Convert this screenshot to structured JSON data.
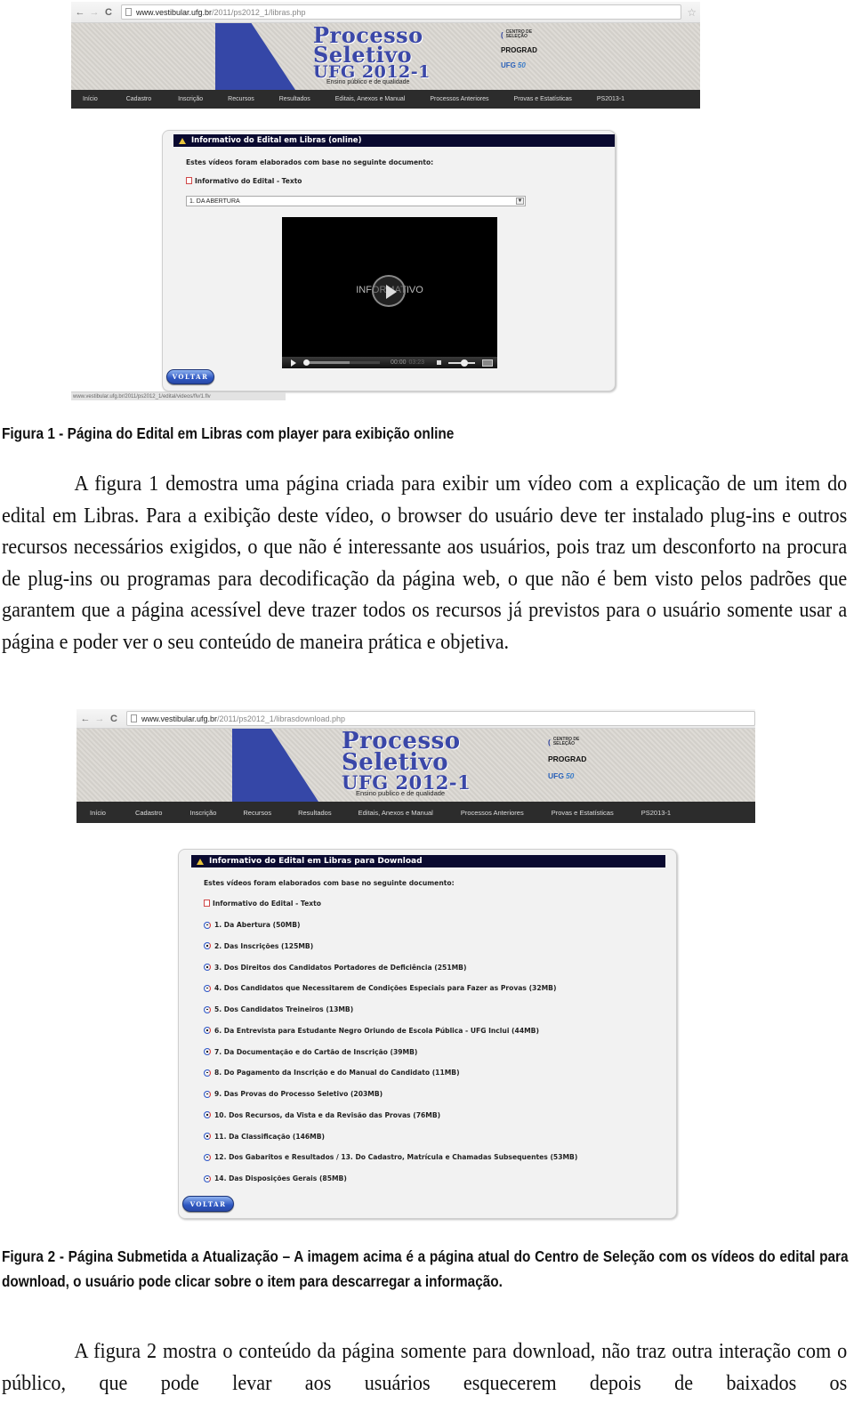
{
  "figure1": {
    "browser": {
      "nav": {
        "back": "←",
        "forward": "→",
        "reload": "C",
        "star": "☆"
      },
      "url_host": "www.vestibular.ufg.br",
      "url_path": "/2011/ps2012_1/libras.php"
    },
    "banner": {
      "title_line1": "Processo",
      "title_line2": "Seletivo",
      "title_line3": "UFG 2012-1",
      "tagline": "Ensino público e de qualidade",
      "logos": {
        "centro": "CENTRO DE SELEÇÃO",
        "prograd": "PROGRAD",
        "ufg": "UFG",
        "ufg_50": "50"
      }
    },
    "menu": [
      "Início",
      "Cadastro",
      "Inscrição",
      "Recursos",
      "Resultados",
      "Editais, Anexos e Manual",
      "Processos Anteriores",
      "Provas e Estatísticas",
      "PS2013-1"
    ],
    "panel": {
      "heading": "Informativo do Edital em Libras (online)",
      "intro": "Estes vídeos foram elaborados com base no seguinte documento:",
      "doc_link": "Informativo do Edital - Texto",
      "select_value": "1. DA ABERTURA",
      "video": {
        "overlay_text": "INFORMATIVO",
        "current_time": "00:00",
        "duration": "03:23",
        "progress_fraction": 0.0,
        "buffered_fraction": 0.6,
        "volume_fraction": 0.6
      },
      "back_button": "VOLTAR"
    },
    "status_url": "www.vestibular.ufg.br/2011/ps2012_1/edital/videos/flv/1.flv",
    "caption": "Figura 1 - Página do Edital em Libras com player para exibição online"
  },
  "paragraph1": "A figura 1 demostra uma página criada para exibir um vídeo com a explicação de um item do edital em Libras. Para a exibição deste vídeo, o browser do usuário deve ter instalado plug-ins e outros recursos necessários exigidos, o que não é interessante aos usuários, pois traz um desconforto na procura de plug-ins ou programas para decodificação da página web, o que não é bem visto pelos padrões que garantem que a página acessível deve trazer todos os recursos já previstos para o usuário somente usar a página e poder ver o seu conteúdo de maneira prática e objetiva.",
  "figure2": {
    "browser": {
      "nav": {
        "back": "←",
        "forward": "→",
        "reload": "C"
      },
      "url_host": "www.vestibular.ufg.br",
      "url_path": "/2011/ps2012_1/librasdownload.php"
    },
    "banner": {
      "title_line1": "Processo",
      "title_line2": "Seletivo",
      "title_line3": "UFG 2012-1",
      "tagline": "Ensino publico e de qualidade",
      "logos": {
        "centro": "CENTRO DE SELEÇÃO",
        "prograd": "PROGRAD",
        "ufg": "UFG",
        "ufg_50": "50"
      }
    },
    "menu": [
      "Início",
      "Cadastro",
      "Inscrição",
      "Recursos",
      "Resultados",
      "Editais, Anexos e Manual",
      "Processos Anteriores",
      "Provas e Estatísticas",
      "PS2013-1"
    ],
    "panel": {
      "heading": "Informativo do Edital em Libras para Download",
      "intro": "Estes vídeos foram elaborados com base no seguinte documento:",
      "doc_link": "Informativo do Edital - Texto",
      "downloads": [
        "1. Da Abertura (50MB)",
        "2. Das Inscrições (125MB)",
        "3. Dos Direitos dos Candidatos Portadores de Deficiência (251MB)",
        "4. Dos Candidatos que Necessitarem de Condições Especiais para Fazer as Provas (32MB)",
        "5. Dos Candidatos Treineiros (13MB)",
        "6. Da Entrevista para Estudante Negro Oriundo de Escola Pública - UFG Inclui (44MB)",
        "7. Da Documentação e do Cartão de Inscrição (39MB)",
        "8. Do Pagamento da Inscrição e do Manual do Candidato (11MB)",
        "9. Das Provas do Processo Seletivo (203MB)",
        "10. Dos Recursos, da Vista e da Revisão das Provas (76MB)",
        "11. Da Classificação (146MB)",
        "12. Dos Gabaritos e Resultados / 13. Do Cadastro, Matrícula e Chamadas Subsequentes (53MB)",
        "14. Das Disposições Gerais (85MB)"
      ],
      "back_button": "VOLTAR"
    },
    "caption": "Figura 2 - Página Submetida a Atualização – A imagem acima é a página atual do Centro de Seleção com os vídeos do edital para download, o usuário pode clicar sobre o item para descarregar a informação."
  },
  "paragraph2": "A figura 2 mostra o conteúdo da página somente para download, não traz outra interação com o público, que pode levar aos usuários esquecerem depois de baixados os"
}
